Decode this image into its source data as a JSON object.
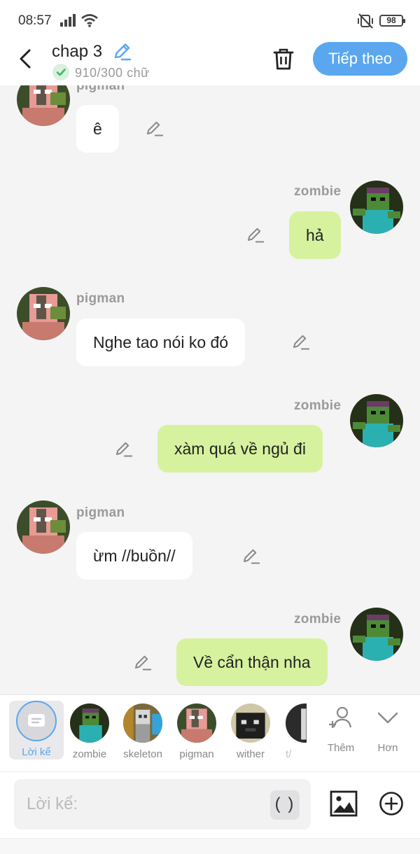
{
  "status": {
    "time": "08:57",
    "battery": "98"
  },
  "header": {
    "title": "chap 3",
    "word_count": "910/300 chữ",
    "next_label": "Tiếp theo"
  },
  "messages": [
    {
      "speaker": "pigman",
      "text": "ê",
      "side": "left"
    },
    {
      "speaker": "zombie",
      "text": "hả",
      "side": "right"
    },
    {
      "speaker": "pigman",
      "text": "Nghe tao nói ko đó",
      "side": "left"
    },
    {
      "speaker": "zombie",
      "text": "xàm quá về ngủ đi",
      "side": "right"
    },
    {
      "speaker": "pigman",
      "text": "ừm  //buồn//",
      "side": "left"
    },
    {
      "speaker": "zombie",
      "text": "Về cẩn thận nha",
      "side": "right"
    }
  ],
  "characters": [
    {
      "label": "Lời kể",
      "selected": true
    },
    {
      "label": "zombie"
    },
    {
      "label": "skeleton"
    },
    {
      "label": "pigman"
    },
    {
      "label": "wither"
    },
    {
      "label": "t/"
    }
  ],
  "actions": {
    "add_label": "Thêm",
    "more_label": "Hơn"
  },
  "composer": {
    "placeholder": "Lời kể:",
    "paren_label": "( )"
  },
  "colors": {
    "accent": "#5aa7f0",
    "right_bubble": "#d6f29f",
    "check": "#3dbb5b"
  }
}
